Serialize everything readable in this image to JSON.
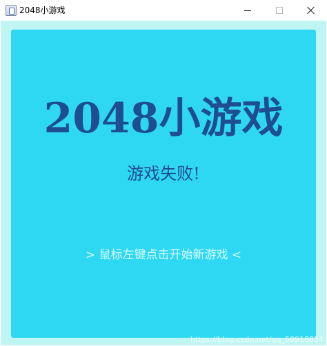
{
  "window": {
    "title": "2048小游戏",
    "icon": "java-app-icon"
  },
  "game": {
    "title": "2048小游戏",
    "status": "游戏失败!",
    "prompt": "> 鼠标左键点击开始新游戏 <"
  },
  "watermark": {
    "text": "https://blog.csdn.net/qq_50918834"
  },
  "colors": {
    "frame": "#bff6f4",
    "panel": "#2ed8f2",
    "title_text": "#1f4d91",
    "prompt_text": "#d8fbff"
  }
}
